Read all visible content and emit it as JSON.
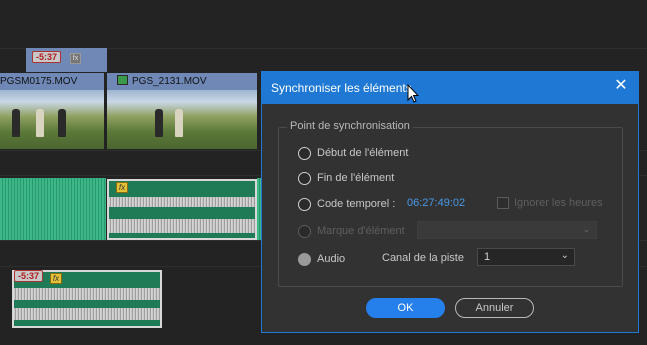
{
  "timeline": {
    "top_offset_badge": "-5:37",
    "bottom_offset_badge": "-5:37",
    "clip1_name": "PGS_0175.MOV",
    "clip1_name_visible": "PGSM0175.MOV",
    "clip2_name": "PGS_2131.MOV",
    "fx_label": "fx"
  },
  "dialog": {
    "title": "Synchroniser les éléments",
    "close_icon": "close-icon",
    "group_label": "Point de synchronisation",
    "options": {
      "start": "Début de l'élément",
      "end": "Fin de l'élément",
      "timecode": "Code temporel :",
      "marker": "Marque d'élément",
      "audio": "Audio"
    },
    "selected_option": "audio",
    "timecode_value": "06:27:49:02",
    "ignore_hours_label": "Ignorer les heures",
    "track_channel_label": "Canal de la piste",
    "track_channel_value": "1",
    "ok_label": "OK",
    "cancel_label": "Annuler"
  },
  "colors": {
    "accent": "#1e78d4",
    "ok_button": "#2680eb",
    "timecode": "#4a9ae8",
    "video_clip": "#6f88b6",
    "audio_clip": "#3fb58a"
  }
}
